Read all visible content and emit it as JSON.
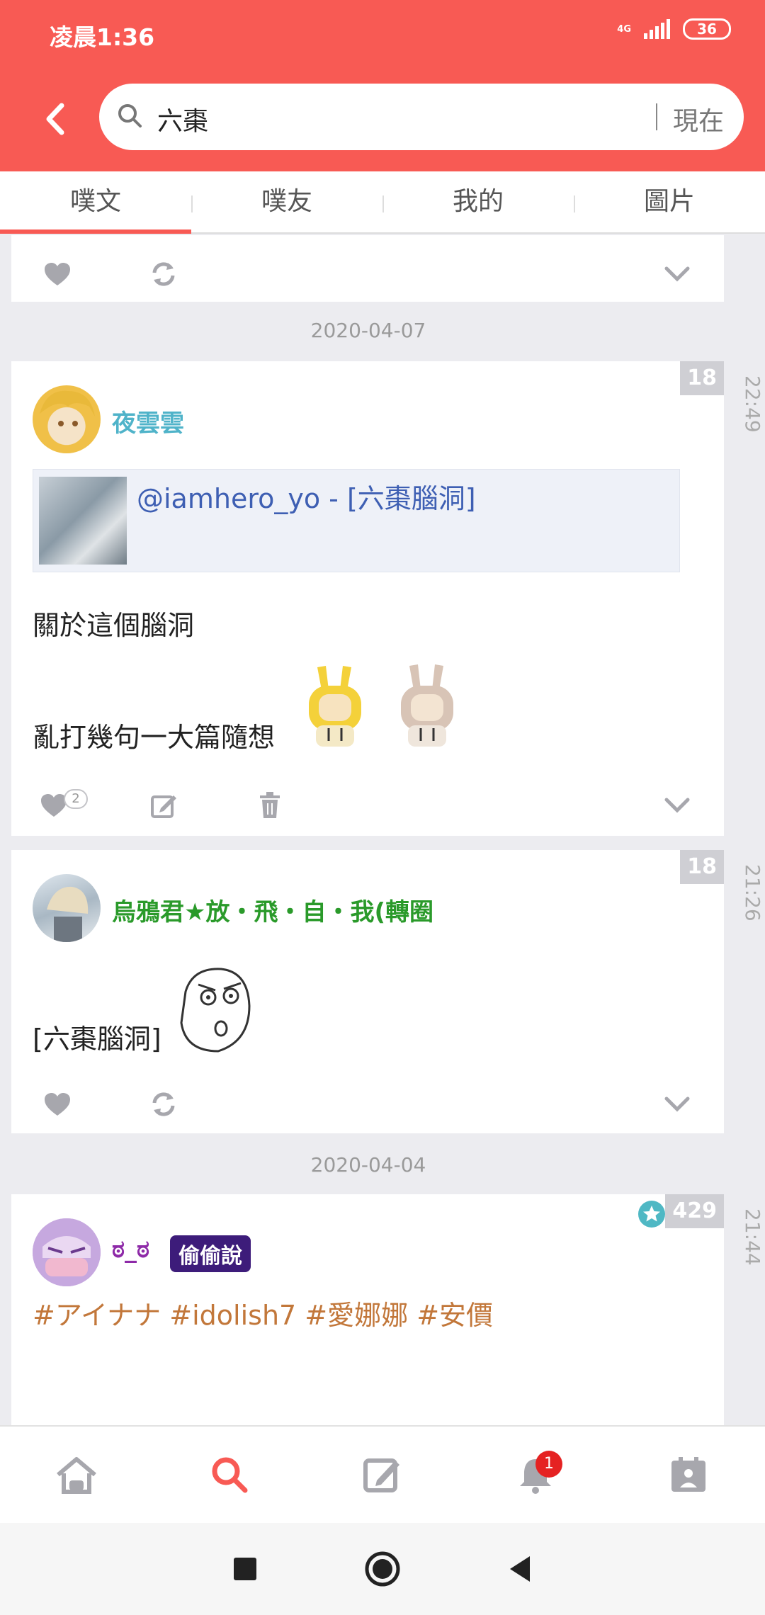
{
  "status_bar": {
    "time": "凌晨1:36",
    "network": "4G",
    "battery": "36"
  },
  "search": {
    "query": "六棗",
    "time_filter": "現在"
  },
  "tabs": [
    {
      "label": "噗文",
      "active": true
    },
    {
      "label": "噗友",
      "active": false
    },
    {
      "label": "我的",
      "active": false
    },
    {
      "label": "圖片",
      "active": false
    }
  ],
  "date_separators": [
    "2020-04-07",
    "2020-04-04"
  ],
  "posts": [
    {
      "author": "夜雲雲",
      "author_color": "#4fb3c9",
      "count": "18",
      "time": "22:49",
      "quote": "@iamhero_yo - [六棗腦洞]",
      "lines": [
        "關於這個腦洞",
        "亂打幾句一大篇隨想"
      ],
      "likes": "2"
    },
    {
      "author": "烏鴉君★放・飛・自・我(轉圈",
      "author_color": "#2a9a2a",
      "count": "18",
      "time": "21:26",
      "lines": [
        "[六棗腦洞]"
      ]
    },
    {
      "author": "ಠ_ಠ",
      "author_color": "#8e2aa8",
      "badge": "偷偷說",
      "count": "429",
      "time": "21:44",
      "hashtags": "#アイナナ #idolish7 #愛娜娜 #安價"
    }
  ],
  "bottom_nav": {
    "notification_count": "1"
  },
  "colors": {
    "brand": "#f85a54",
    "active_search": "#f85a54",
    "icon_gray": "#a7a7ad"
  }
}
